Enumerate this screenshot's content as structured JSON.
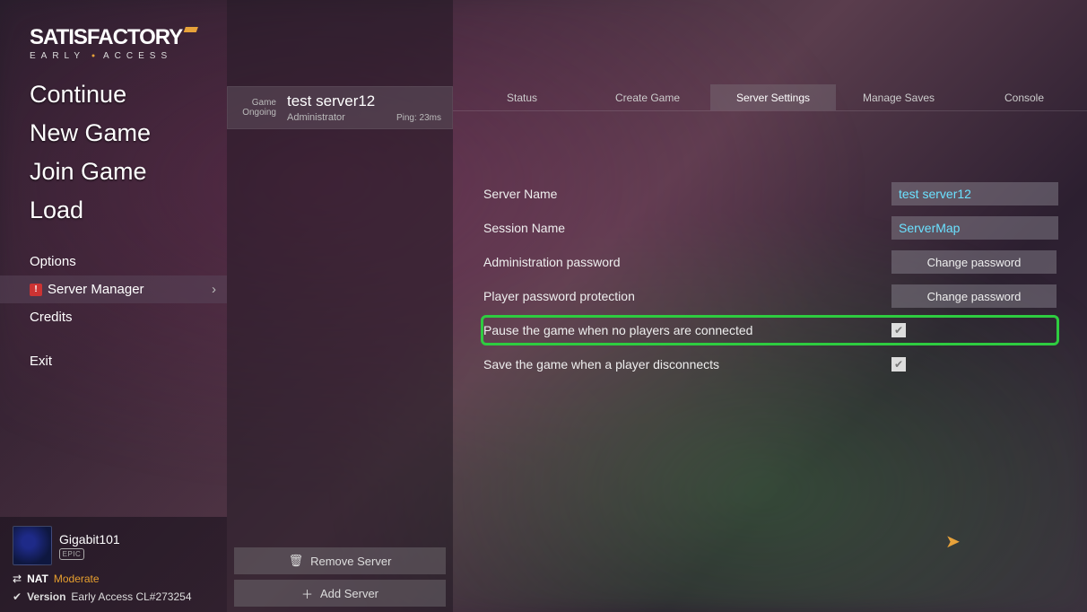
{
  "logo": {
    "title": "SATISFACTORY",
    "subtitle": "EARLY · ACCESS"
  },
  "mainMenu": {
    "continue": "Continue",
    "newGame": "New Game",
    "joinGame": "Join Game",
    "load": "Load"
  },
  "subMenu": {
    "options": "Options",
    "serverManager": "Server Manager",
    "credits": "Credits",
    "exit": "Exit"
  },
  "player": {
    "name": "Gigabit101",
    "platform": "EPIC"
  },
  "nat": {
    "label": "NAT",
    "value": "Moderate"
  },
  "version": {
    "label": "Version",
    "value": "Early Access CL#273254"
  },
  "serverList": {
    "entries": [
      {
        "statusLine1": "Game",
        "statusLine2": "Ongoing",
        "name": "test server12",
        "role": "Administrator",
        "ping": "Ping: 23ms"
      }
    ],
    "removeBtn": "Remove Server",
    "addBtn": "Add Server"
  },
  "tabs": {
    "status": "Status",
    "createGame": "Create Game",
    "serverSettings": "Server Settings",
    "manageSaves": "Manage Saves",
    "console": "Console"
  },
  "settings": {
    "serverName": {
      "label": "Server Name",
      "value": "test server12"
    },
    "sessionName": {
      "label": "Session Name",
      "value": "ServerMap"
    },
    "adminPassword": {
      "label": "Administration password",
      "button": "Change password"
    },
    "playerPassword": {
      "label": "Player password protection",
      "button": "Change password"
    },
    "pauseNoPlayers": {
      "label": "Pause the game when no players are connected",
      "checked": true
    },
    "saveOnDisconnect": {
      "label": "Save the game when a player disconnects",
      "checked": true
    }
  }
}
